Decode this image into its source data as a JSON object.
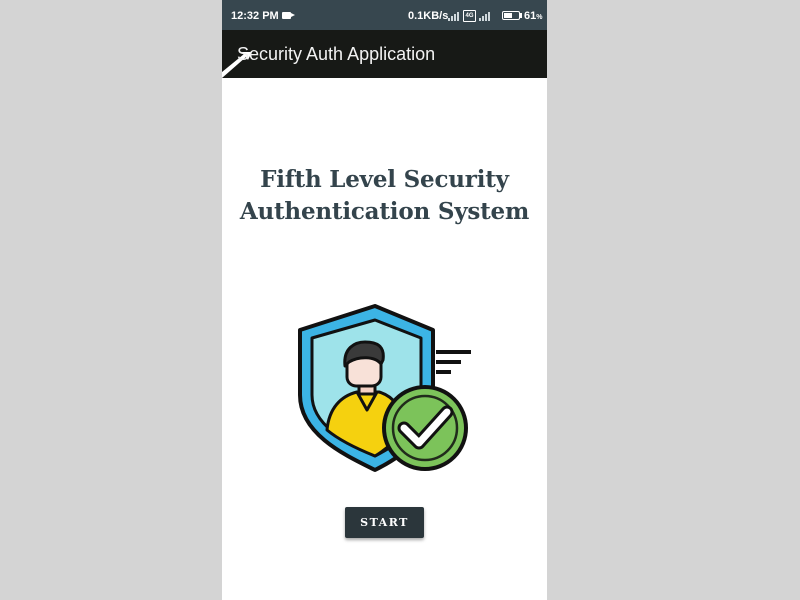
{
  "status_bar": {
    "time": "12:32 PM",
    "network_speed": "0.1KB/s",
    "volte_label": "4G",
    "battery_percent_text": "61",
    "battery_level": 0.61
  },
  "app_bar": {
    "title": "Security Auth Application"
  },
  "main": {
    "headline_line1": "Fifth Level Security",
    "headline_line2": "Authentication System",
    "illustration_icon": "shield-user-check-icon",
    "start_label": "START"
  },
  "colors": {
    "status_bar_bg": "#37474f",
    "app_bar_bg": "#171916",
    "headline_text": "#34444c",
    "button_bg": "#2b363b",
    "shield_blue": "#3cb4e5",
    "shield_inner": "#9ee3ea",
    "check_green": "#7cc35a",
    "shirt_yellow": "#f5d10f"
  }
}
